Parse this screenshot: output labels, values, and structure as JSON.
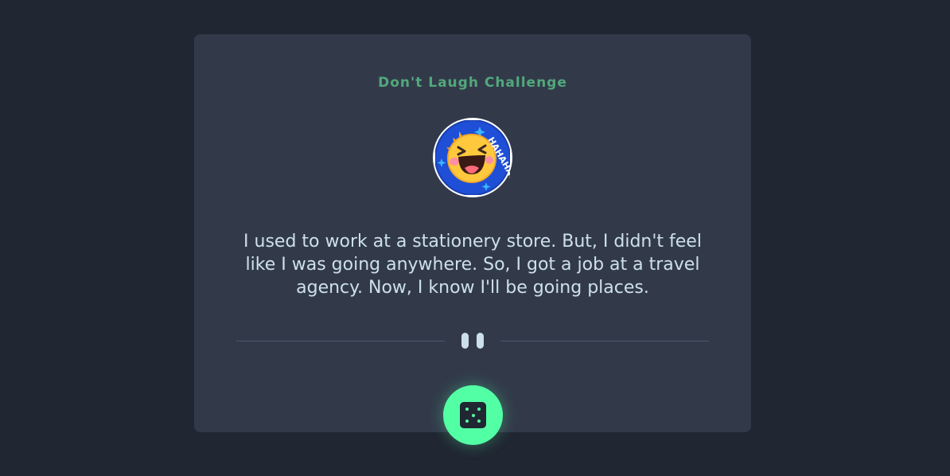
{
  "header": {
    "title": "Don't Laugh Challenge"
  },
  "avatar": {
    "icon": "laughing-sun-sticker-icon",
    "text": "HAHAHA!"
  },
  "joke": {
    "text": "I used to work at a stationery store. But, I didn't feel like I was going anywhere. So, I got a job at a travel agency. Now, I know I'll be going places."
  },
  "divider": {
    "icon": "quote-icon"
  },
  "action": {
    "icon": "dice-icon"
  },
  "colors": {
    "background": "#202632",
    "card": "#323a4a",
    "accent": "#53ffa4",
    "title": "#52a87b",
    "text": "#cde0ea"
  }
}
